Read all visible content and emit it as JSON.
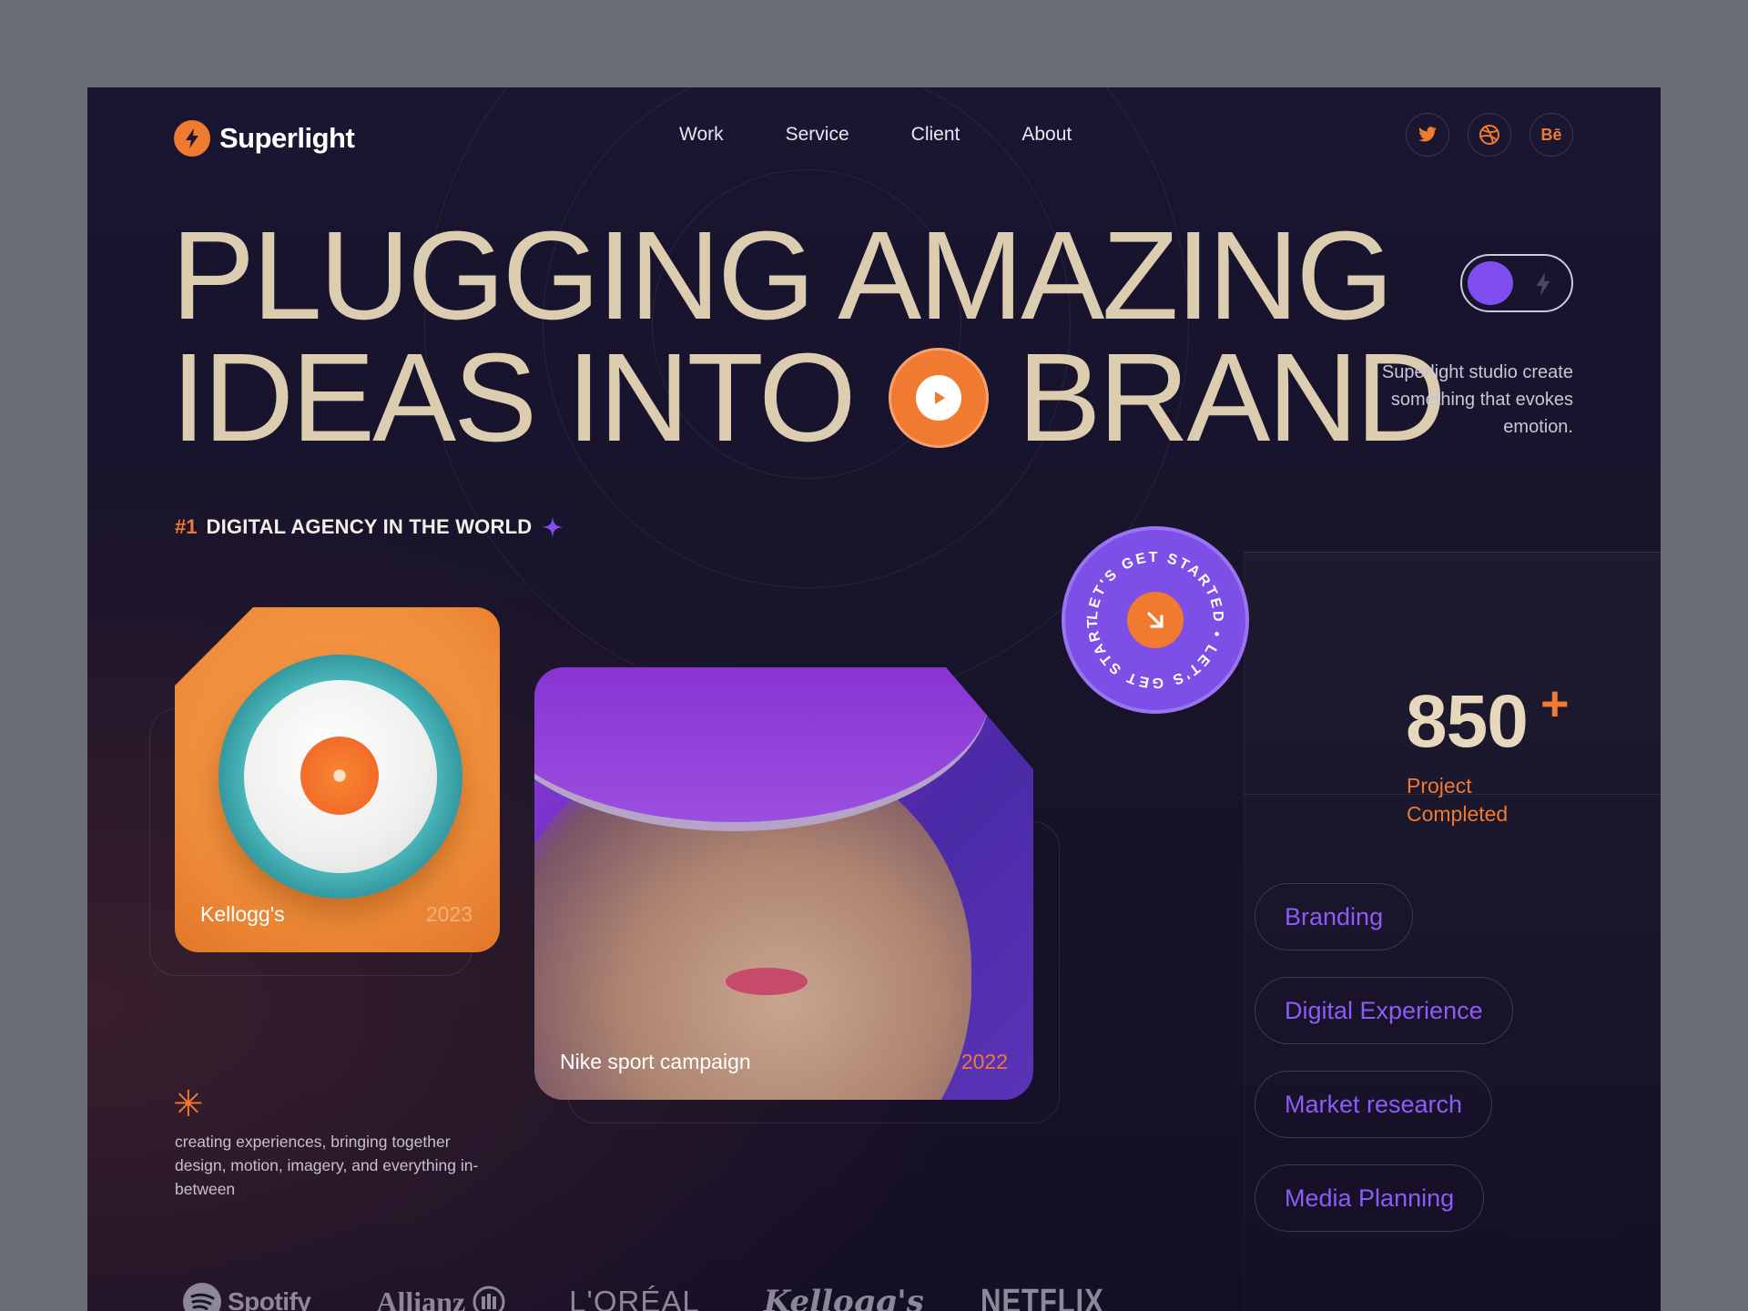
{
  "brand": {
    "name": "Superlight"
  },
  "nav": [
    "Work",
    "Service",
    "Client",
    "About"
  ],
  "socials": [
    {
      "icon": "twitter-icon"
    },
    {
      "icon": "dribbble-icon"
    },
    {
      "icon": "behance-icon",
      "label": "Bē"
    }
  ],
  "hero": {
    "line1": "PLUGGING AMAZING",
    "line2_left": "IDEAS INTO",
    "line2_right": "BRAND"
  },
  "toggle": {
    "state": "on"
  },
  "tagline": "Superlight studio create something that evokes emotion.",
  "agency": {
    "rank": "#1",
    "text": "DIGITAL AGENCY IN THE WORLD"
  },
  "badge": {
    "circular_text": "LET'S GET STARTED • LET'S GET STARTED •"
  },
  "stat": {
    "number": "850",
    "suffix": "+",
    "label": "Project Completed"
  },
  "cards": [
    {
      "title": "Kellogg's",
      "year": "2023"
    },
    {
      "title": "Nike sport campaign",
      "year": "2022"
    }
  ],
  "description": "creating experiences, bringing together design, motion, imagery, and everything in-between",
  "clients": [
    "Spotify",
    "Allianz",
    "L'ORÉAL",
    "Kellogg's",
    "NETFLIX"
  ],
  "services": [
    "Branding",
    "Digital Experience",
    "Market research",
    "Media Planning"
  ],
  "colors": {
    "accent": "#f07a2f",
    "purple": "#7f4df0",
    "background": "#17132a",
    "headline": "#ddcdb0"
  }
}
